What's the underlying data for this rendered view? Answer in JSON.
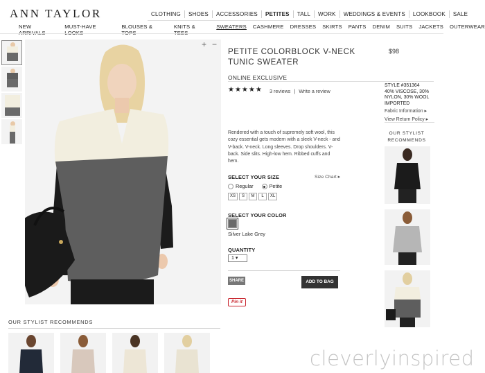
{
  "brand": {
    "logo": "ANN TAYLOR"
  },
  "topnav": [
    "CLOTHING",
    "SHOES",
    "ACCESSORIES",
    "PETITES",
    "TALL",
    "WORK",
    "WEDDINGS & EVENTS",
    "LOOKBOOK",
    "SALE"
  ],
  "subnav": [
    "NEW ARRIVALS",
    "MUST-HAVE LOOKS",
    "BLOUSES & TOPS",
    "KNITS & TEES",
    "SWEATERS",
    "CASHMERE",
    "DRESSES",
    "SKIRTS",
    "PANTS",
    "DENIM",
    "SUITS",
    "JACKETS",
    "OUTERWEAR"
  ],
  "gallery": {
    "zoom_in": "+",
    "zoom_out": "−"
  },
  "product": {
    "title": "PETITE COLORBLOCK V-NECK TUNIC SWEATER",
    "price": "$98",
    "badge": "ONLINE EXCLUSIVE",
    "stars": "★★★★★",
    "reviews": "3 reviews",
    "write_review": "Write a review",
    "style": "STYLE #351364",
    "fabric": "40% VISCOSE, 30% NYLON, 30% WOOL IMPORTED",
    "fabric_info": "Fabric Information ▸",
    "return_policy": "View Return Policy ▸",
    "description": "Rendered with a touch of supremely soft wool, this cozy essential gets modern with a sleek V-neck - and V-back. V-neck. Long sleeves. Drop shoulders. V-back. Side slits. High-low hem. Ribbed cuffs and hem."
  },
  "size": {
    "label": "SELECT YOUR SIZE",
    "chart_link": "Size Chart ▸",
    "options": [
      "Regular",
      "Petite"
    ],
    "sizes": [
      "XS",
      "S",
      "M",
      "L",
      "XL"
    ]
  },
  "color": {
    "label": "SELECT YOUR COLOR",
    "name": "Silver Lake Grey",
    "swatch": "#6a6a6a"
  },
  "quantity": {
    "label": "QUANTITY",
    "value": "1 ▾"
  },
  "buttons": {
    "share": "SHARE",
    "add_to_bag": "ADD TO BAG",
    "pin_it": "Pin it"
  },
  "stylist_side": {
    "heading": "OUR STYLIST RECOMMENDS"
  },
  "stylist_bottom": {
    "heading": "OUR STYLIST RECOMMENDS"
  },
  "watermark": "cleverlyinspired",
  "colors": {
    "cream": "#f2eedf",
    "charcoal": "#5e5e5e",
    "black": "#1b1b1b",
    "pin_red": "#c8232c"
  }
}
